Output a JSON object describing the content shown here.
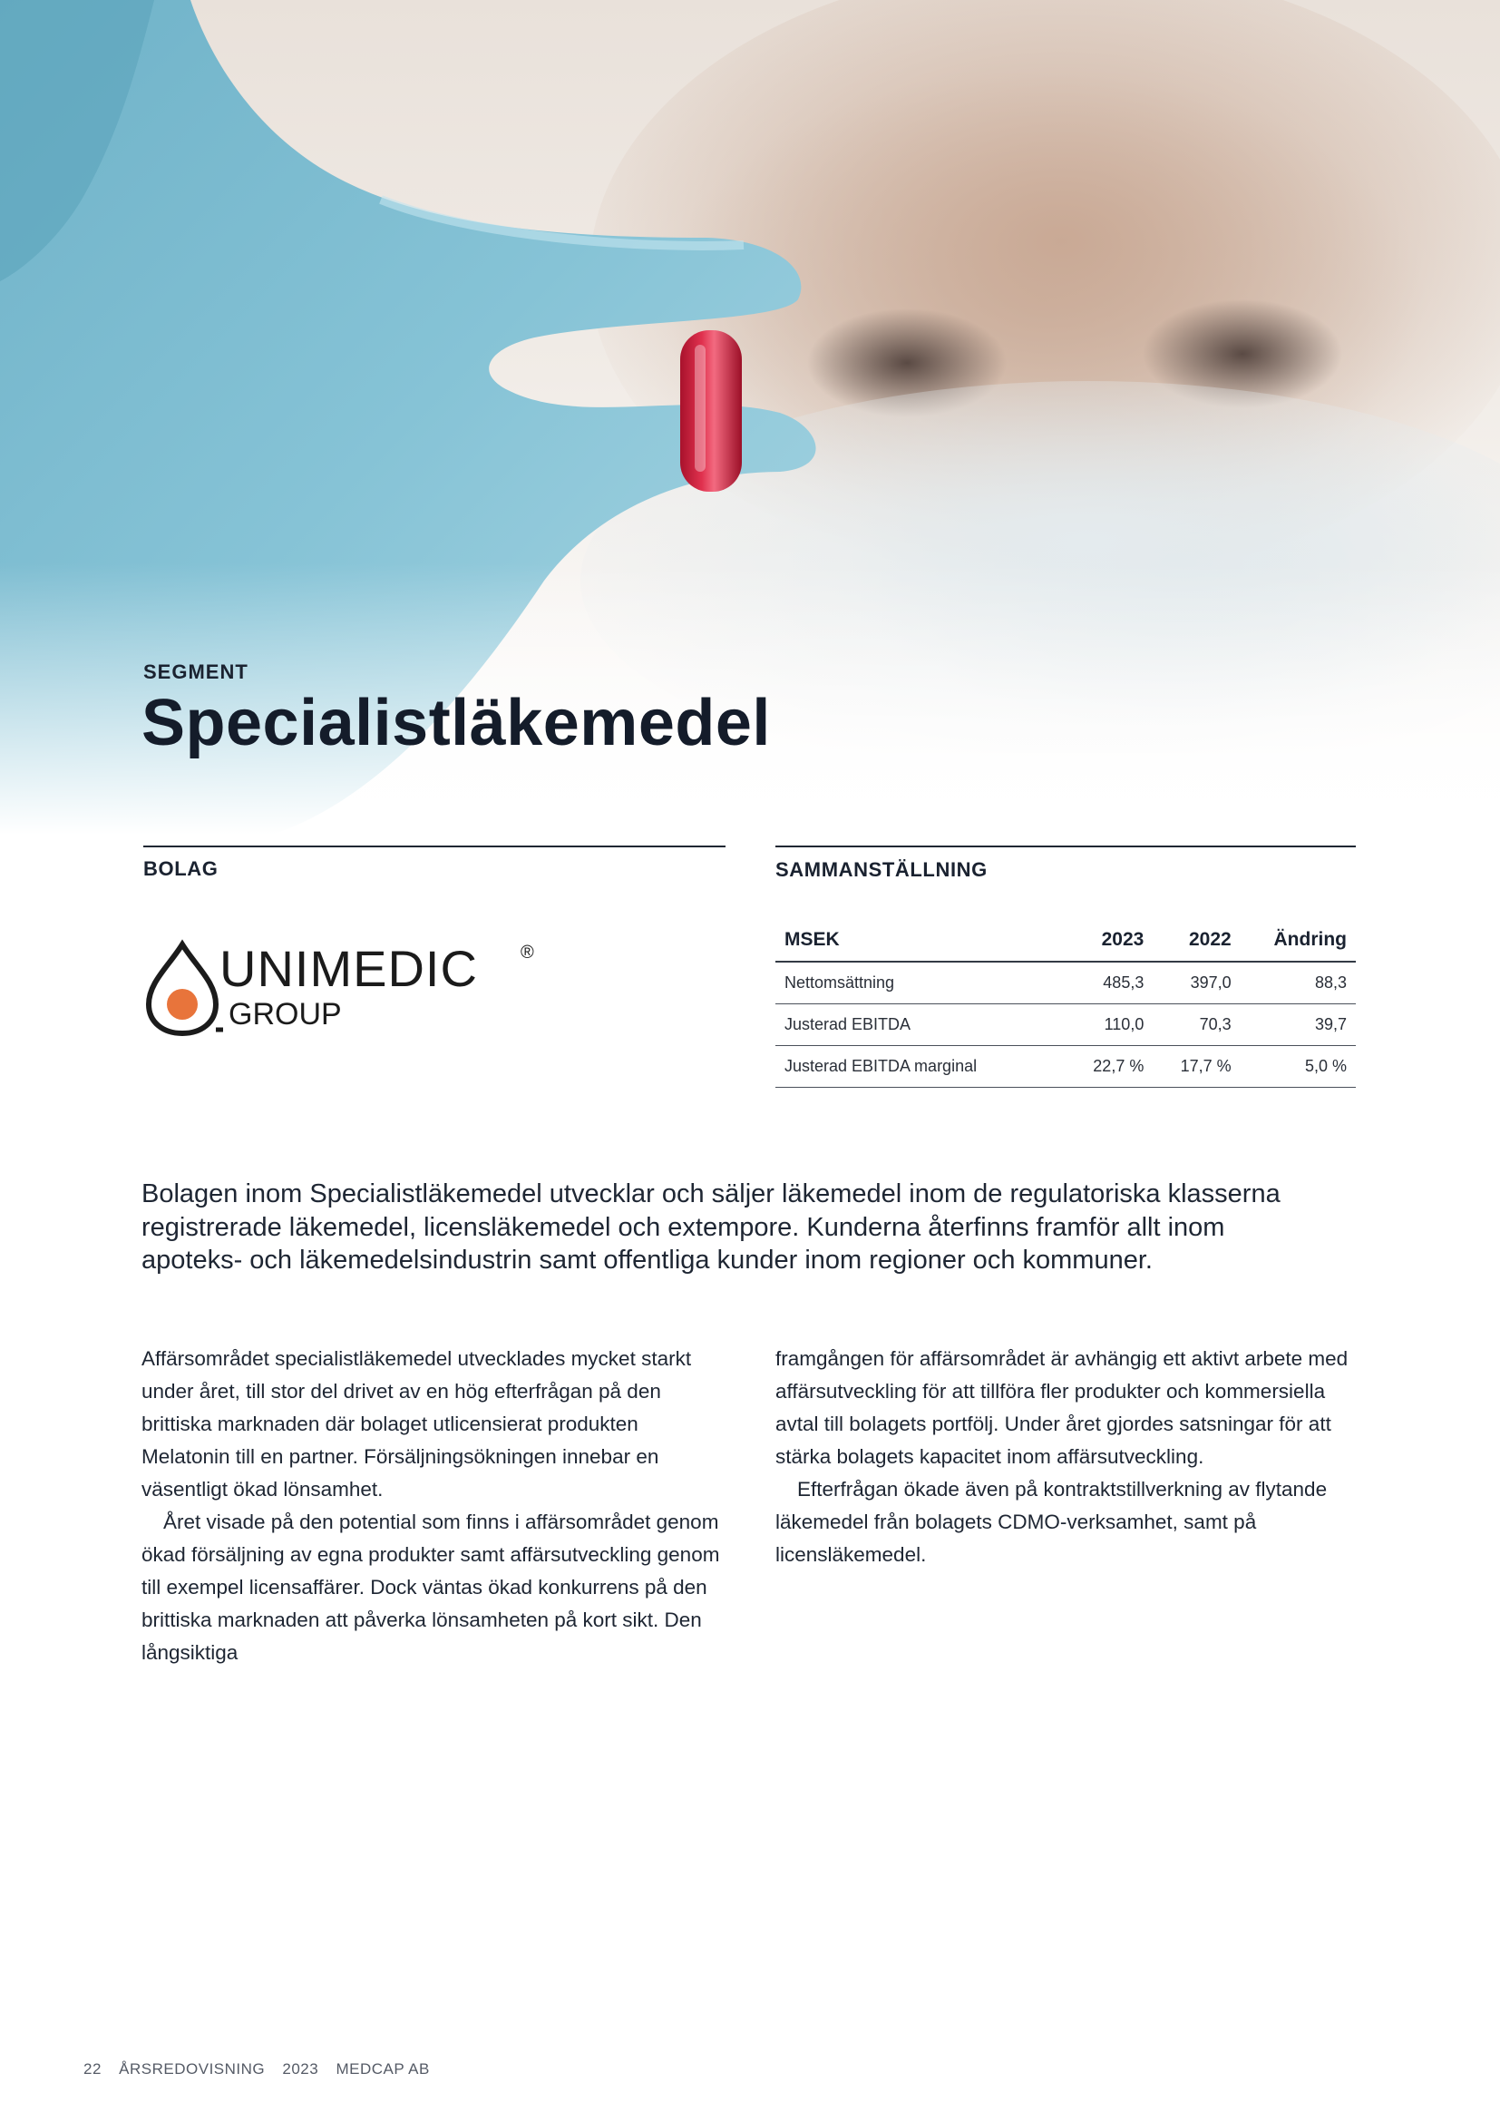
{
  "header": {
    "eyebrow": "SEGMENT",
    "title": "Specialistläkemedel"
  },
  "company_section": {
    "label": "BOLAG",
    "logo": {
      "wordmark": "UNIMEDIC",
      "registered": "®",
      "sub": "GROUP",
      "icon": "drop-icon",
      "colors": {
        "dot": "#e8743b",
        "ink": "#1b1b1b"
      }
    }
  },
  "summary_section": {
    "label": "SAMMANSTÄLLNING",
    "table": {
      "headers": [
        "MSEK",
        "2023",
        "2022",
        "Ändring"
      ],
      "rows": [
        [
          "Nettomsättning",
          "485,3",
          "397,0",
          "88,3"
        ],
        [
          "Justerad EBITDA",
          "110,0",
          "70,3",
          "39,7"
        ],
        [
          "Justerad EBITDA marginal",
          "22,7 %",
          "17,7 %",
          "5,0 %"
        ]
      ]
    }
  },
  "intro": "Bolagen inom Specialistläkemedel utvecklar och säljer läkemedel inom de regulatoriska klasserna registrerade läkemedel, licensläkemedel och extempore. Kunderna återfinns framför allt inom apoteks- och läkemedelsindustrin samt offentliga kunder inom regioner och kommuner.",
  "body": {
    "left": [
      "Affärsområdet specialistläkemedel utvecklades mycket starkt under året, till stor del drivet av en hög efterfrågan på den brittiska marknaden där bolaget utlicensierat produkten Melatonin till en partner. Försäljningsökningen innebar en väsentligt ökad lönsamhet.",
      "Året visade på den potential som finns i affärsområdet genom ökad försäljning av egna produkter samt affärsutveckling genom till exempel licensaffärer. Dock väntas ökad konkurrens på den brittiska marknaden att påverka lönsamheten på kort sikt. Den långsiktiga"
    ],
    "right": [
      "framgången för affärsområdet är avhängig ett aktivt arbete med affärsutveckling för att tillföra fler produkter och kommersiella avtal till bolagets portfölj. Under året gjordes satsningar för att stärka bolagets kapacitet inom affärsutveckling.",
      "Efterfrågan ökade även på kontraktstillverkning av flytande läkemedel från bolagets CDMO-verksamhet, samt på licensläkemedel."
    ]
  },
  "footer": {
    "page": "22",
    "doc": "ÅRSREDOVISNING",
    "year": "2023",
    "company": "MEDCAP AB"
  }
}
